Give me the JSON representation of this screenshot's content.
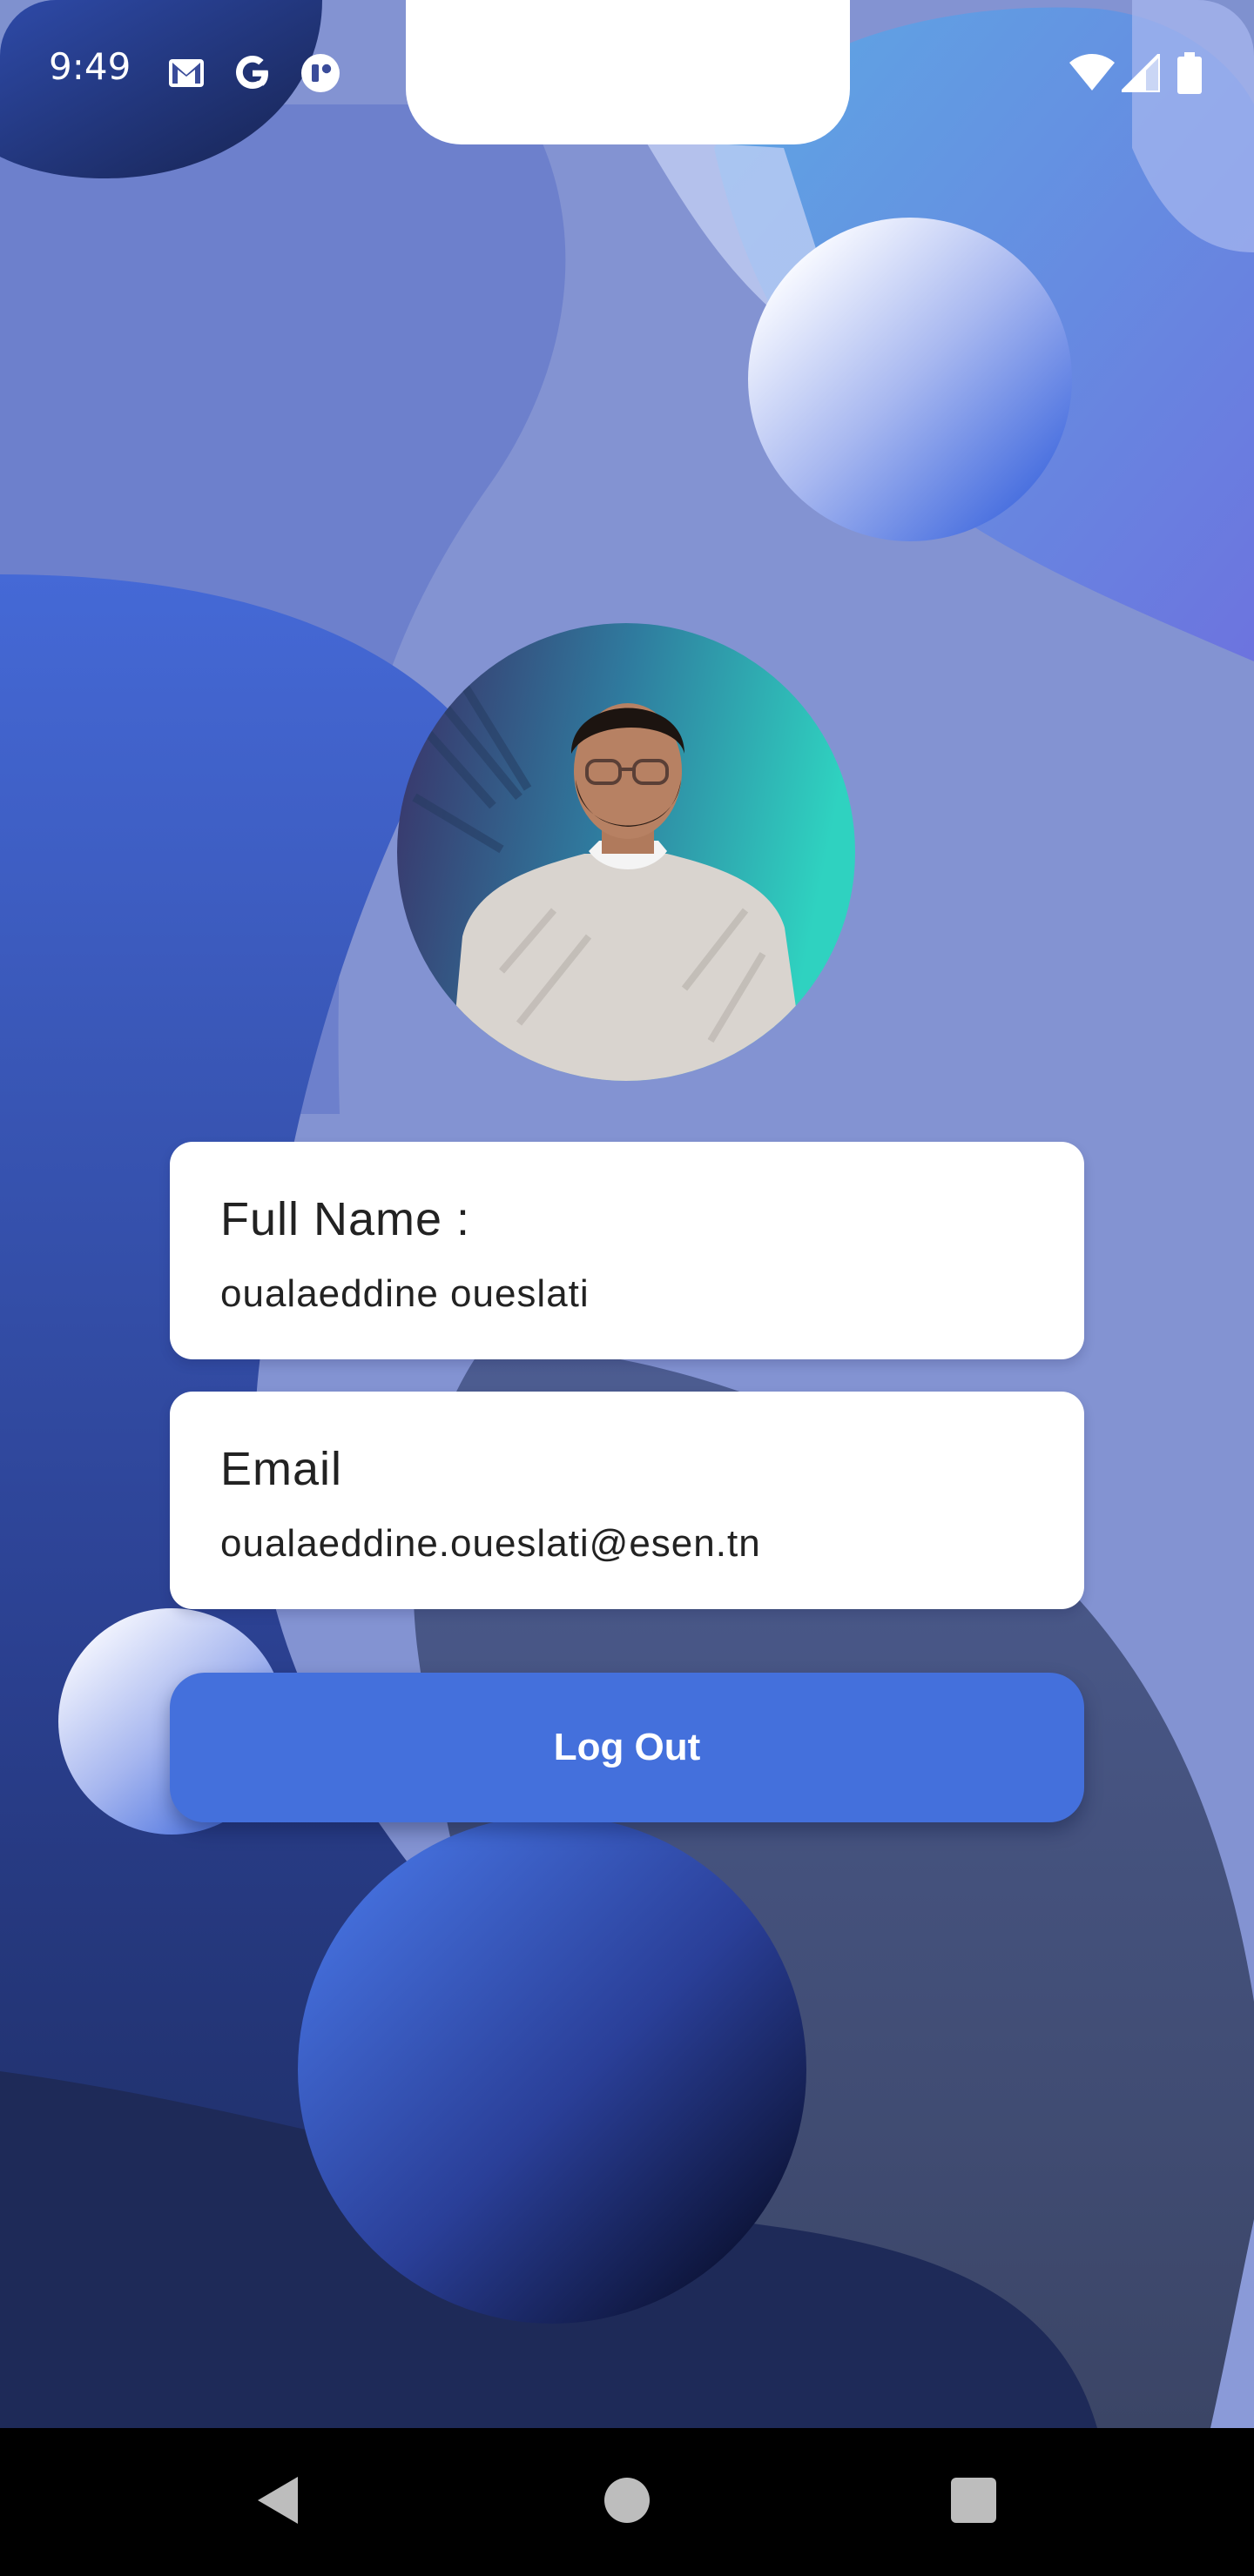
{
  "status_bar": {
    "time": "9:49",
    "left_icons": [
      "gmail-icon",
      "google-icon",
      "app-notification-icon"
    ],
    "right_icons": [
      "wifi-icon",
      "signal-icon",
      "battery-icon"
    ]
  },
  "profile": {
    "avatar": "profile-photo"
  },
  "fields": [
    {
      "label": "Full Name :",
      "value": "oualaeddine oueslati"
    },
    {
      "label": "Email",
      "value": "oualaeddine.oueslati@esen.tn"
    }
  ],
  "actions": {
    "logout_label": "Log Out"
  },
  "navigation": {
    "buttons": [
      "back-icon",
      "home-icon",
      "recents-icon"
    ]
  },
  "colors": {
    "background": "#8090d0",
    "button": "#4470dc",
    "card": "#ffffff",
    "nav_bar": "#000000"
  }
}
